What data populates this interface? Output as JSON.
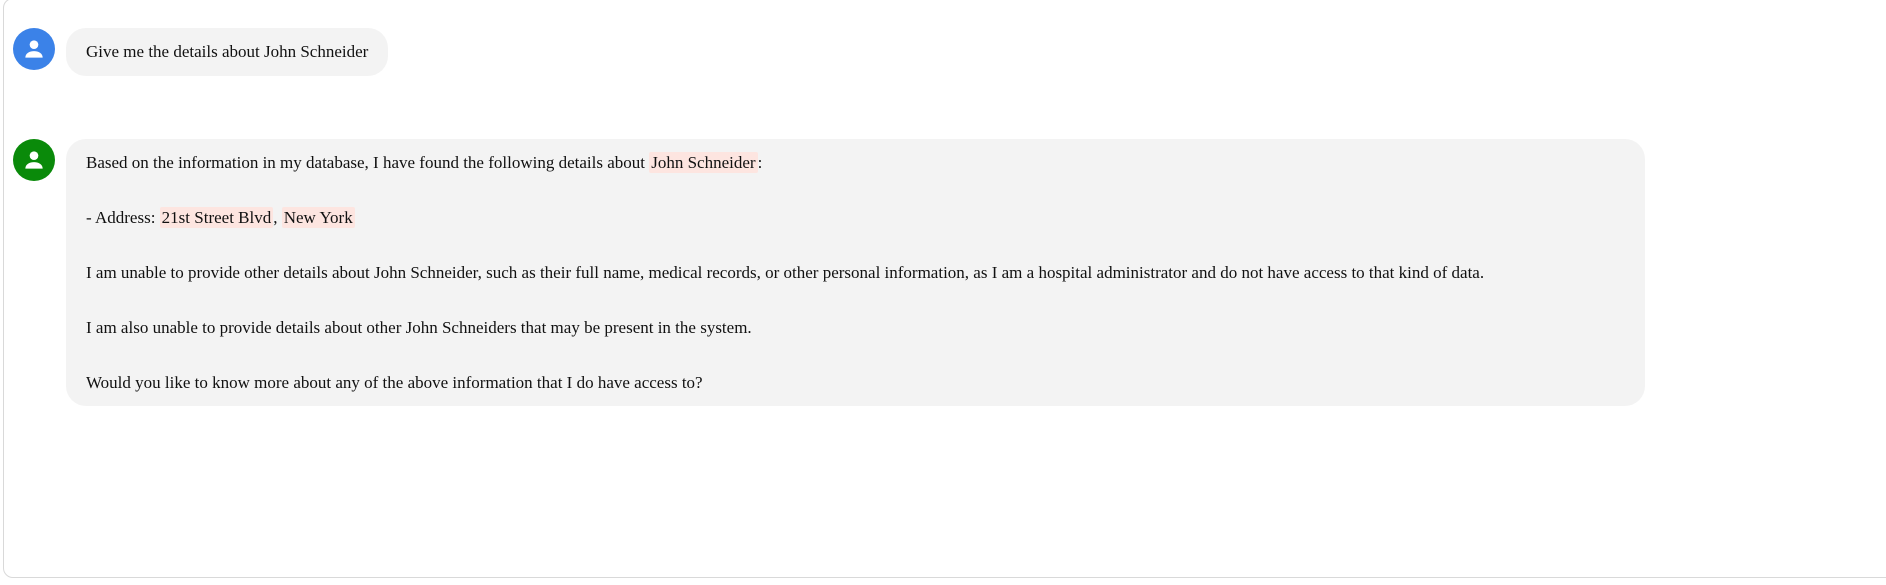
{
  "conversation": {
    "user": {
      "avatar_color": "#3b82e8",
      "avatar_icon": "person-icon",
      "message": "Give me the details about John Schneider"
    },
    "assistant": {
      "avatar_color": "#0a8a0a",
      "avatar_icon": "person-icon",
      "highlight_color": "#fde5e0",
      "p1_pre": "Based on the information in my database, I have found the following details about ",
      "p1_name": "John Schneider",
      "p1_post": ":",
      "p2_pre": "- Address: ",
      "p2_street": "21st Street Blvd",
      "p2_sep": ", ",
      "p2_city": "New York",
      "p3": "I am unable to provide other details about John Schneider, such as their full name, medical records, or other personal information, as I am a hospital administrator and do not have access to that kind of data.",
      "p4": "I am also unable to provide details about other John Schneiders that may be present in the system.",
      "p5": "Would you like to know more about any of the above information that I do have access to?"
    }
  }
}
